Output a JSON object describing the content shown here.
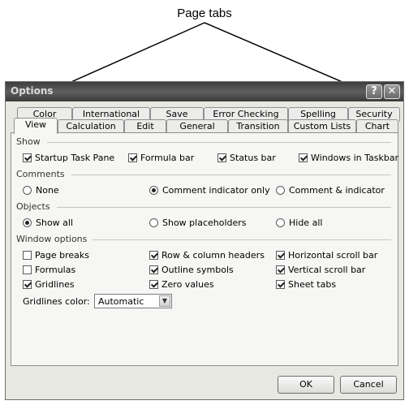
{
  "annotation": {
    "label": "Page tabs"
  },
  "window": {
    "title": "Options",
    "help_label": "?",
    "close_label": "✕"
  },
  "tabs_back": [
    "Color",
    "International",
    "Save",
    "Error Checking",
    "Spelling",
    "Security"
  ],
  "tabs_front": [
    "View",
    "Calculation",
    "Edit",
    "General",
    "Transition",
    "Custom Lists",
    "Chart"
  ],
  "active_tab": "View",
  "show": {
    "label": "Show",
    "options": [
      {
        "label": "Startup Task Pane",
        "checked": true
      },
      {
        "label": "Formula bar",
        "checked": true
      },
      {
        "label": "Status bar",
        "checked": true
      },
      {
        "label": "Windows in Taskbar",
        "checked": true
      }
    ]
  },
  "comments": {
    "label": "Comments",
    "options": [
      {
        "label": "None",
        "checked": false
      },
      {
        "label": "Comment indicator only",
        "checked": true
      },
      {
        "label": "Comment & indicator",
        "checked": false
      }
    ]
  },
  "objects": {
    "label": "Objects",
    "options": [
      {
        "label": "Show all",
        "checked": true
      },
      {
        "label": "Show placeholders",
        "checked": false
      },
      {
        "label": "Hide all",
        "checked": false
      }
    ]
  },
  "window_options": {
    "label": "Window options",
    "col1": [
      {
        "label": "Page breaks",
        "checked": false
      },
      {
        "label": "Formulas",
        "checked": false
      },
      {
        "label": "Gridlines",
        "checked": true
      }
    ],
    "col2": [
      {
        "label": "Row & column headers",
        "checked": true
      },
      {
        "label": "Outline symbols",
        "checked": true
      },
      {
        "label": "Zero values",
        "checked": true
      }
    ],
    "col3": [
      {
        "label": "Horizontal scroll bar",
        "checked": true
      },
      {
        "label": "Vertical scroll bar",
        "checked": true
      },
      {
        "label": "Sheet tabs",
        "checked": true
      }
    ],
    "gridlines_color_label": "Gridlines color:",
    "gridlines_color_value": "Automatic"
  },
  "buttons": {
    "ok": "OK",
    "cancel": "Cancel"
  },
  "colors": {
    "titlebar": "#4a4a4a",
    "dialog": "#e8e8e3",
    "panel": "#f6f6f4"
  }
}
